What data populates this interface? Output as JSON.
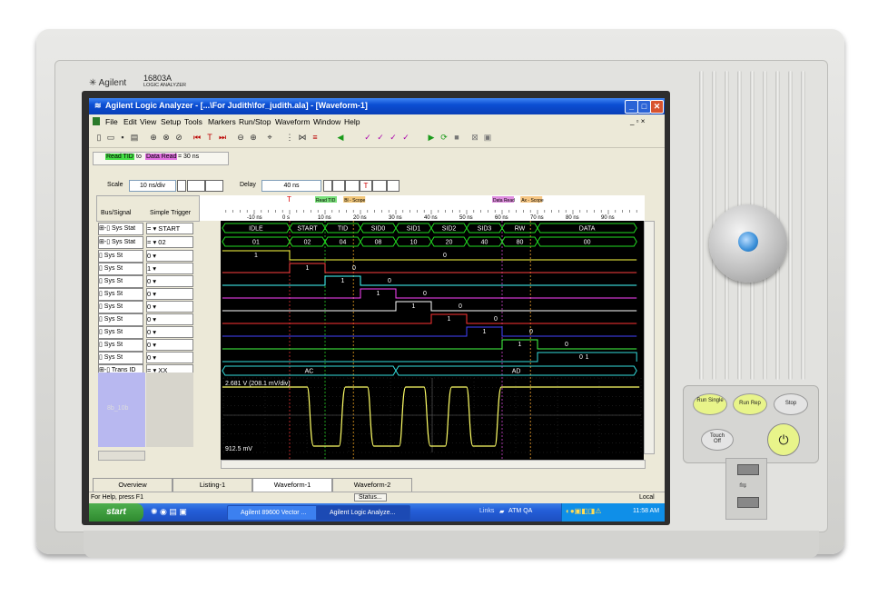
{
  "instrument": {
    "brand": "Agilent",
    "model": "16803A",
    "subtitle": "LOGIC ANALYZER"
  },
  "window": {
    "title": "Agilent Logic Analyzer - [...\\For Judith\\for_judith.ala] - [Waveform-1]"
  },
  "menu": [
    "File",
    "Edit",
    "View",
    "Setup",
    "Tools",
    "Markers",
    "Run/Stop",
    "Waveform",
    "Window",
    "Help"
  ],
  "measure": {
    "from": "Read TID",
    "to_word": "to",
    "to": "Data Read",
    "result": "= 30 ns"
  },
  "controls": {
    "scale_label": "Scale",
    "scale_value": "10 ns/div",
    "delay_label": "Delay",
    "delay_value": "40 ns"
  },
  "columns": {
    "bus_signal": "Bus/Signal",
    "simple_trigger": "Simple Trigger"
  },
  "time_axis": {
    "ticks": [
      "-10 ns",
      "0 s",
      "10 ns",
      "20 ns",
      "30 ns",
      "40 ns",
      "50 ns",
      "60 ns",
      "70 ns",
      "80 ns",
      "90 ns"
    ]
  },
  "markers": [
    {
      "label": "Read TID",
      "color": "#22cc22"
    },
    {
      "label": "Bl - Scope",
      "color": "#e8a020"
    },
    {
      "label": "Data Read",
      "color": "#cc44cc"
    },
    {
      "label": "Ax - Scope",
      "color": "#f0a030"
    }
  ],
  "signals": [
    {
      "name": "Sys Stat",
      "trigger": "START",
      "op": "="
    },
    {
      "name": "Sys Stat",
      "trigger": "02",
      "op": "="
    },
    {
      "name": "Sys St",
      "trigger": "0"
    },
    {
      "name": "Sys St",
      "trigger": "1"
    },
    {
      "name": "Sys St",
      "trigger": "0"
    },
    {
      "name": "Sys St",
      "trigger": "0"
    },
    {
      "name": "Sys St",
      "trigger": "0"
    },
    {
      "name": "Sys St",
      "trigger": "0"
    },
    {
      "name": "Sys St",
      "trigger": "0"
    },
    {
      "name": "Sys St",
      "trigger": "0"
    },
    {
      "name": "Sys St",
      "trigger": "0"
    },
    {
      "name": "Trans ID",
      "trigger": "XX",
      "op": "="
    }
  ],
  "bus1_states": [
    "IDLE",
    "START",
    "TID",
    "SID0",
    "SID1",
    "SID2",
    "SID3",
    "RW",
    "DATA"
  ],
  "bus2_values": [
    "01",
    "02",
    "04",
    "08",
    "10",
    "20",
    "40",
    "80",
    "00"
  ],
  "trans_values": [
    "AC",
    "AD"
  ],
  "scope": {
    "channel": "8b_10b",
    "top_reading": "2.681 V (208.1 mV/div)",
    "bottom_reading": "912.5 mV"
  },
  "tabs": [
    "Overview",
    "Listing-1",
    "Waveform-1",
    "Waveform-2"
  ],
  "status": {
    "help": "For Help, press F1",
    "status_btn": "Status...",
    "mode": "Local"
  },
  "taskbar": {
    "start": "start",
    "tasks": [
      "Agilent 89600 Vector ...",
      "Agilent Logic Analyze..."
    ],
    "links": "Links",
    "atm": "ATM QA",
    "clock": "11:58 AM"
  },
  "hw_buttons": {
    "run_single": "Run Single",
    "run_rep": "Run Rep",
    "stop": "Stop",
    "touch_off": "Touch Off"
  }
}
